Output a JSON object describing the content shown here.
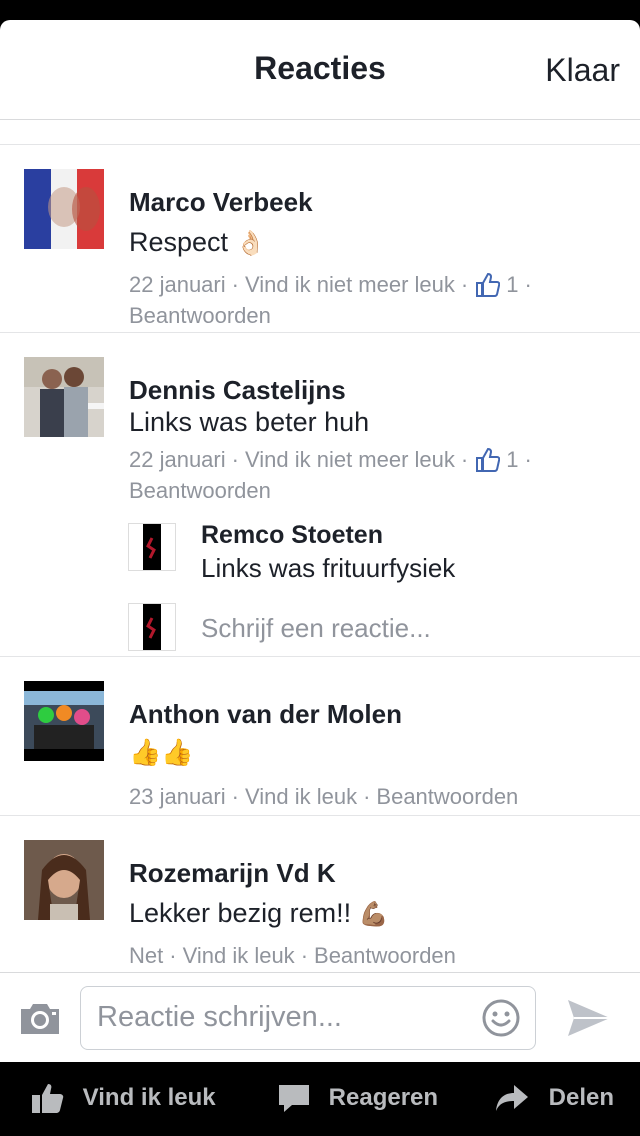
{
  "header": {
    "title": "Reacties",
    "done_label": "Klaar"
  },
  "comments": [
    {
      "name": "Marco Verbeek",
      "text": "Respect",
      "emoji": "👌🏻",
      "time": "22 januari",
      "like_action": "Vind ik niet meer leuk",
      "likes": "1",
      "reply_action": "Beantwoorden"
    },
    {
      "name": "Dennis Castelijns",
      "text": "Links was beter huh",
      "time": "22 januari",
      "like_action": "Vind ik niet meer leuk",
      "likes": "1",
      "reply_action": "Beantwoorden",
      "replies": [
        {
          "name": "Remco Stoeten",
          "text": "Links was frituurfysiek"
        }
      ],
      "reply_placeholder": "Schrijf een reactie..."
    },
    {
      "name": "Anthon van der Molen",
      "emoji": "👍👍",
      "time": "23 januari",
      "like_action": "Vind ik leuk",
      "reply_action": "Beantwoorden"
    },
    {
      "name": "Rozemarijn Vd K",
      "text": "Lekker bezig rem!!",
      "emoji": "💪🏽",
      "time": "Net",
      "like_action": "Vind ik leuk",
      "reply_action": "Beantwoorden"
    }
  ],
  "composer": {
    "placeholder": "Reactie schrijven..."
  },
  "bottom_bar": {
    "like_label": "Vind ik leuk",
    "comment_label": "Reageren",
    "share_label": "Delen"
  },
  "colors": {
    "text": "#1d2129",
    "meta": "#90949c",
    "like_blue": "#4267b2",
    "divider": "#d9dadc"
  },
  "icons": [
    "camera-icon",
    "emoji-icon",
    "send-icon",
    "thumbs-up-icon",
    "comment-icon",
    "share-icon"
  ]
}
